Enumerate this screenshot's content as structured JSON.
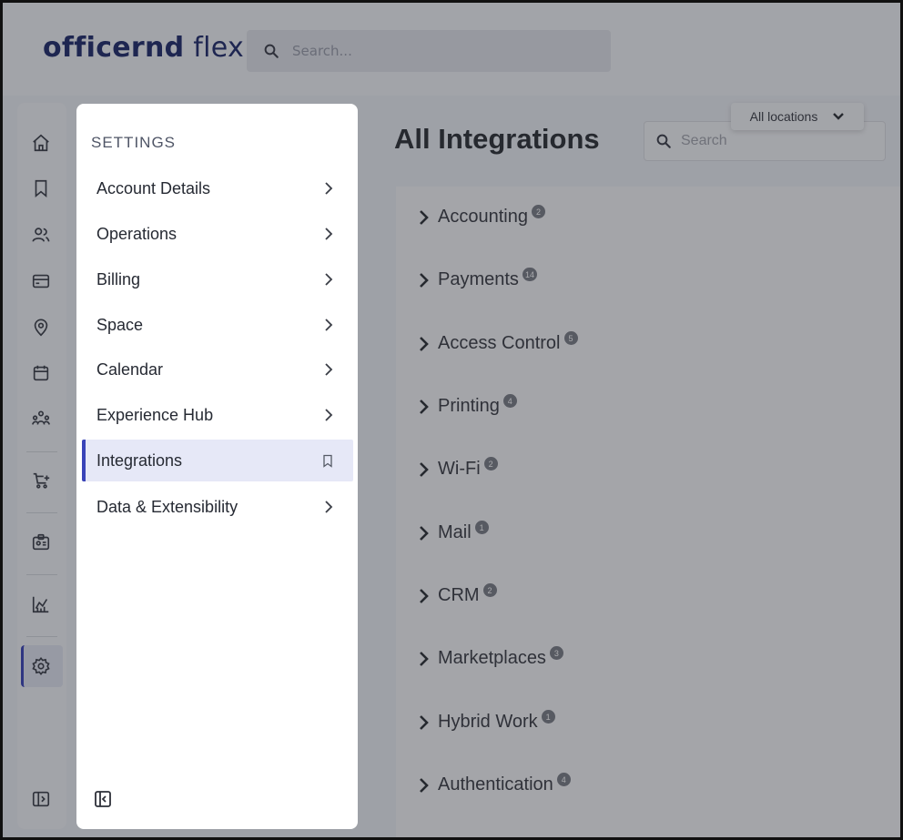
{
  "header": {
    "logo_main": "officernd",
    "logo_sub": " flex",
    "search_placeholder": "Search..."
  },
  "rail": {
    "icons": [
      "home-icon",
      "bookmark-icon",
      "users-icon",
      "card-icon",
      "location-pin-icon",
      "calendar-icon",
      "community-icon",
      "cart-plus-icon",
      "badge-icon",
      "analytics-icon",
      "settings-gear-icon",
      "sidebar-toggle-icon"
    ],
    "active": "settings-gear-icon"
  },
  "settings": {
    "title": "SETTINGS",
    "items": [
      {
        "label": "Account Details",
        "icon": "chevron-right-icon"
      },
      {
        "label": "Operations",
        "icon": "chevron-right-icon"
      },
      {
        "label": "Billing",
        "icon": "chevron-right-icon"
      },
      {
        "label": "Space",
        "icon": "chevron-right-icon"
      },
      {
        "label": "Calendar",
        "icon": "chevron-right-icon"
      },
      {
        "label": "Experience Hub",
        "icon": "chevron-right-icon"
      },
      {
        "label": "Integrations",
        "icon": "bookmark-icon",
        "active": true
      },
      {
        "label": "Data & Extensibility",
        "icon": "chevron-right-icon"
      }
    ],
    "collapse_icon": "collapse-panel-icon"
  },
  "main": {
    "title": "All Integrations",
    "location_filter": "All locations",
    "search_placeholder": "Search",
    "categories": [
      {
        "label": "Accounting",
        "count": "2"
      },
      {
        "label": "Payments",
        "count": "14"
      },
      {
        "label": "Access Control",
        "count": "5"
      },
      {
        "label": "Printing",
        "count": "4"
      },
      {
        "label": "Wi-Fi",
        "count": "2"
      },
      {
        "label": "Mail",
        "count": "1"
      },
      {
        "label": "CRM",
        "count": "2"
      },
      {
        "label": "Marketplaces",
        "count": "3"
      },
      {
        "label": "Hybrid Work",
        "count": "1"
      },
      {
        "label": "Authentication",
        "count": "4"
      }
    ]
  },
  "colors": {
    "accent": "#3a44b8",
    "brand": "#1f2a6b",
    "active_bg": "#e6e8f7"
  }
}
